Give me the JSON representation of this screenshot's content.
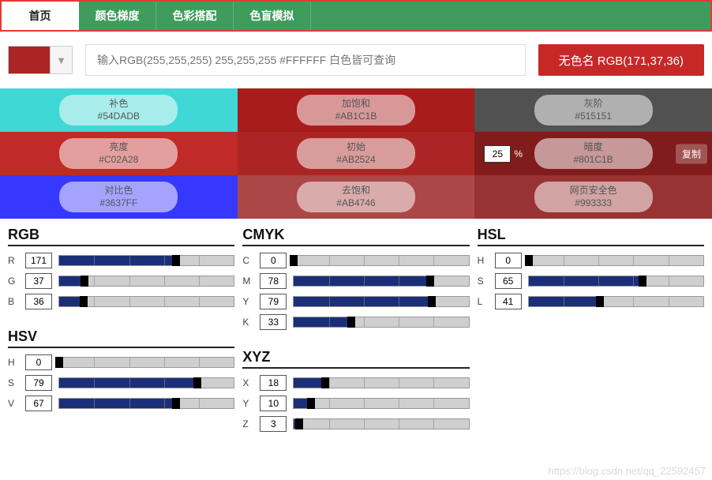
{
  "tabs": {
    "items": [
      {
        "label": "首页",
        "active": true
      },
      {
        "label": "颜色梯度",
        "active": false
      },
      {
        "label": "色彩搭配",
        "active": false
      },
      {
        "label": "色盲模拟",
        "active": false
      }
    ]
  },
  "toprow": {
    "swatch_hex": "#AB2524",
    "search_placeholder": "输入RGB(255,255,255) 255,255,255 #FFFFFF 白色皆可查询",
    "result_label": "无色名 RGB(171,37,36)"
  },
  "cards": [
    {
      "title": "补色",
      "hex": "#54DADB",
      "bg": "#3fd8d6"
    },
    {
      "title": "加饱和",
      "hex": "#AB1C1B",
      "bg": "#a81c1b"
    },
    {
      "title": "灰阶",
      "hex": "#515151",
      "bg": "#515151"
    },
    {
      "title": "亮度",
      "hex": "#C02A28",
      "bg": "#c02a28"
    },
    {
      "title": "初始",
      "hex": "#AB2524",
      "bg": "#AB2524"
    },
    {
      "title": "暗度",
      "hex": "#801C1B",
      "bg": "#801c1b",
      "input_value": 25,
      "input_suffix": "%",
      "copy_label": "复制"
    },
    {
      "title": "对比色",
      "hex": "#3637FF",
      "bg": "#3637ff"
    },
    {
      "title": "去饱和",
      "hex": "#AB4746",
      "bg": "#AB4746"
    },
    {
      "title": "网页安全色",
      "hex": "#993333",
      "bg": "#993333"
    }
  ],
  "sliders": {
    "col1": [
      {
        "title": "RGB",
        "rows": [
          {
            "label": "R",
            "value": 171,
            "max": 255
          },
          {
            "label": "G",
            "value": 37,
            "max": 255
          },
          {
            "label": "B",
            "value": 36,
            "max": 255
          }
        ]
      },
      {
        "title": "HSV",
        "rows": [
          {
            "label": "H",
            "value": 0,
            "max": 360
          },
          {
            "label": "S",
            "value": 79,
            "max": 100
          },
          {
            "label": "V",
            "value": 67,
            "max": 100
          }
        ]
      }
    ],
    "col2": [
      {
        "title": "CMYK",
        "rows": [
          {
            "label": "C",
            "value": 0,
            "max": 100
          },
          {
            "label": "M",
            "value": 78,
            "max": 100
          },
          {
            "label": "Y",
            "value": 79,
            "max": 100
          },
          {
            "label": "K",
            "value": 33,
            "max": 100
          }
        ]
      },
      {
        "title": "XYZ",
        "rows": [
          {
            "label": "X",
            "value": 18,
            "max": 100
          },
          {
            "label": "Y",
            "value": 10,
            "max": 100
          },
          {
            "label": "Z",
            "value": 3,
            "max": 100
          }
        ]
      }
    ],
    "col3": [
      {
        "title": "HSL",
        "rows": [
          {
            "label": "H",
            "value": 0,
            "max": 360
          },
          {
            "label": "S",
            "value": 65,
            "max": 100
          },
          {
            "label": "L",
            "value": 41,
            "max": 100
          }
        ]
      }
    ]
  },
  "watermark": "https://blog.csdn.net/qq_22592457"
}
